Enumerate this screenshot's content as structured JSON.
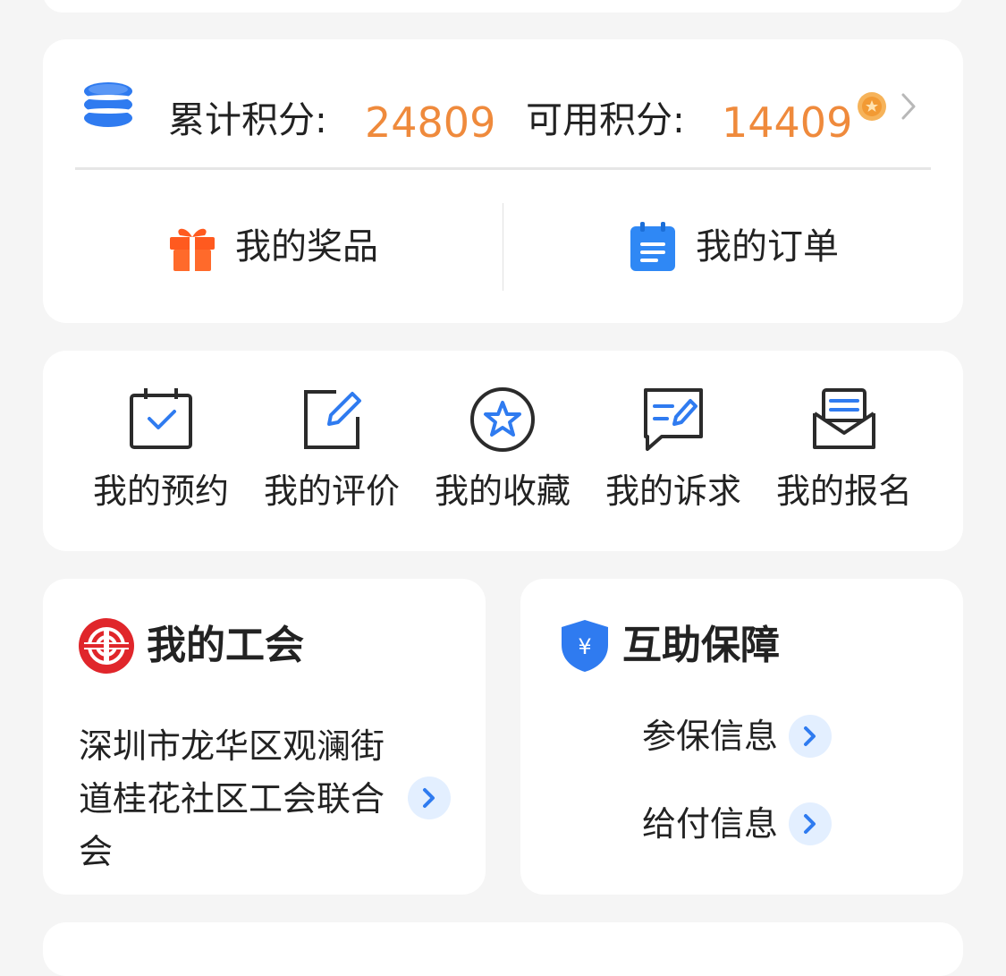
{
  "points": {
    "total_label": "累计积分:",
    "total_value": "24809",
    "available_label": "可用积分:",
    "available_value": "14409",
    "icons": {
      "stack": "coin-stack-icon",
      "coin": "gold-coin-icon",
      "arrow": "chevron-right-icon"
    },
    "colors": {
      "value": "#ef8a3c",
      "stack": "#2f7bf0"
    }
  },
  "shortcuts": [
    {
      "label": "我的奖品",
      "icon": "gift-icon",
      "color": "#ff5a1f"
    },
    {
      "label": "我的订单",
      "icon": "notepad-icon",
      "color": "#2f88f5"
    }
  ],
  "quick_links": [
    {
      "label": "我的预约",
      "icon": "calendar-check-icon"
    },
    {
      "label": "我的评价",
      "icon": "edit-icon"
    },
    {
      "label": "我的收藏",
      "icon": "star-circle-icon"
    },
    {
      "label": "我的诉求",
      "icon": "message-edit-icon"
    },
    {
      "label": "我的报名",
      "icon": "envelope-icon"
    }
  ],
  "union": {
    "title": "我的工会",
    "icon": "union-logo-icon",
    "name": "深圳市龙华区观澜街道桂花社区工会联合会",
    "accent": "#e0262b"
  },
  "insurance": {
    "title": "互助保障",
    "icon": "shield-yuan-icon",
    "items": [
      {
        "label": "参保信息"
      },
      {
        "label": "给付信息"
      }
    ],
    "accent": "#2f7bf0"
  }
}
